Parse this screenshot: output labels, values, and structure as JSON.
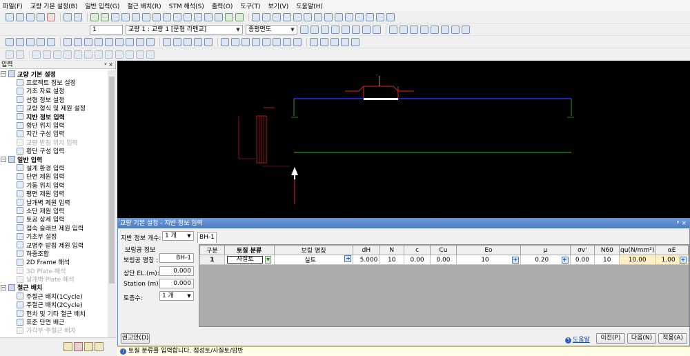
{
  "menu": [
    "파일(F)",
    "교량 기본 설정(B)",
    "일반 입력(G)",
    "철근 배치(R)",
    "STM 해석(S)",
    "출력(O)",
    "도구(T)",
    "보기(V)",
    "도움말(H)"
  ],
  "toolbar2": {
    "page_value": "1",
    "bridge_select": "교량 1 : 교량 1 [문형 라멘교]",
    "view_select": "종평면도"
  },
  "left_panel": {
    "title": "입력",
    "pin": "ᵖ ×",
    "groups": [
      {
        "label": "교량 기본 설정",
        "items": [
          {
            "label": "프로젝트 정보 설정",
            "state": "normal"
          },
          {
            "label": "기초 자료 설정",
            "state": "normal"
          },
          {
            "label": "선형 정보 설정",
            "state": "normal"
          },
          {
            "label": "교량 형식 및 제원 설정",
            "state": "normal"
          },
          {
            "label": "지반 정보 입력",
            "state": "bold"
          },
          {
            "label": "횡단 위치 입력",
            "state": "normal"
          },
          {
            "label": "지간 구성 입력",
            "state": "normal"
          },
          {
            "label": "교량 받침 위치 입력",
            "state": "disabled"
          },
          {
            "label": "횡단 구성 입력",
            "state": "normal"
          }
        ]
      },
      {
        "label": "일반 입력",
        "items": [
          {
            "label": "설계 환경 입력",
            "state": "normal"
          },
          {
            "label": "단면 제원 입력",
            "state": "normal"
          },
          {
            "label": "기둥 위치 입력",
            "state": "normal"
          },
          {
            "label": "평면 제원 입력",
            "state": "normal"
          },
          {
            "label": "날개벽 제원 입력",
            "state": "normal"
          },
          {
            "label": "소단 제원 입력",
            "state": "normal"
          },
          {
            "label": "토공 상세 입력",
            "state": "normal"
          },
          {
            "label": "접속 슬래브 제원 입력",
            "state": "normal"
          },
          {
            "label": "기초부 설정",
            "state": "normal"
          },
          {
            "label": "교명주 받침 제원 입력",
            "state": "normal"
          },
          {
            "label": "하중조합",
            "state": "normal"
          },
          {
            "label": "2D Frame 해석",
            "state": "normal"
          },
          {
            "label": "3D Plate 해석",
            "state": "disabled"
          },
          {
            "label": "날개벽 Plate 해석",
            "state": "disabled"
          }
        ]
      },
      {
        "label": "철근 배치",
        "items": [
          {
            "label": "주철근 배치(1Cycle)",
            "state": "normal"
          },
          {
            "label": "주철근 배치(2Cycle)",
            "state": "normal"
          },
          {
            "label": "헌치 및 기타 철근 배치",
            "state": "normal"
          },
          {
            "label": "표준 단면 배근",
            "state": "normal"
          },
          {
            "label": "가각부 주철근 배치",
            "state": "disabled"
          }
        ]
      }
    ]
  },
  "dialog": {
    "title": "교량 기본 설정 - 지반 정보 입력",
    "controls": "ᵖ ×",
    "count_label": "지반 정보 개수:",
    "count_value": "1 개",
    "tab": "BH-1",
    "group_label": "보링공 정보",
    "fields": [
      {
        "label": "보링공 명칭 :",
        "value": "BH-1"
      },
      {
        "label": "상단 EL.(m):",
        "value": "0.000"
      },
      {
        "label": "Station (m) :",
        "value": "0.000"
      }
    ],
    "layers_label": "토층수:",
    "layers_value": "1 개",
    "columns": [
      "구분",
      "토질 분류",
      "보링 명칭",
      "dH",
      "N",
      "c",
      "Cu",
      "Eo",
      "μ",
      "σv'",
      "N60",
      "qu(N/mm²)",
      "αE"
    ],
    "row": {
      "index": "1",
      "soil": "사질토",
      "name": "실트",
      "dH": "5.000",
      "N": "10",
      "c": "0.00",
      "Cu": "0.00",
      "Eo": "10",
      "mu": "0.20",
      "sv": "0.00",
      "N60": "10",
      "qu": "10.00",
      "aE": "1.00"
    },
    "recommend_button": "권고안(D)",
    "help_link": "도움말",
    "prev_button": "이전(P)",
    "next_button": "다음(N)",
    "apply_button": "적용(A)"
  },
  "status_text": "토질 분류를 입력합니다. 점성토/사질토/암반",
  "icons": [
    "search-icon",
    "pin-icon",
    "close-icon",
    "info-icon",
    "help-icon",
    "plus-icon",
    "chevron-down-icon"
  ]
}
